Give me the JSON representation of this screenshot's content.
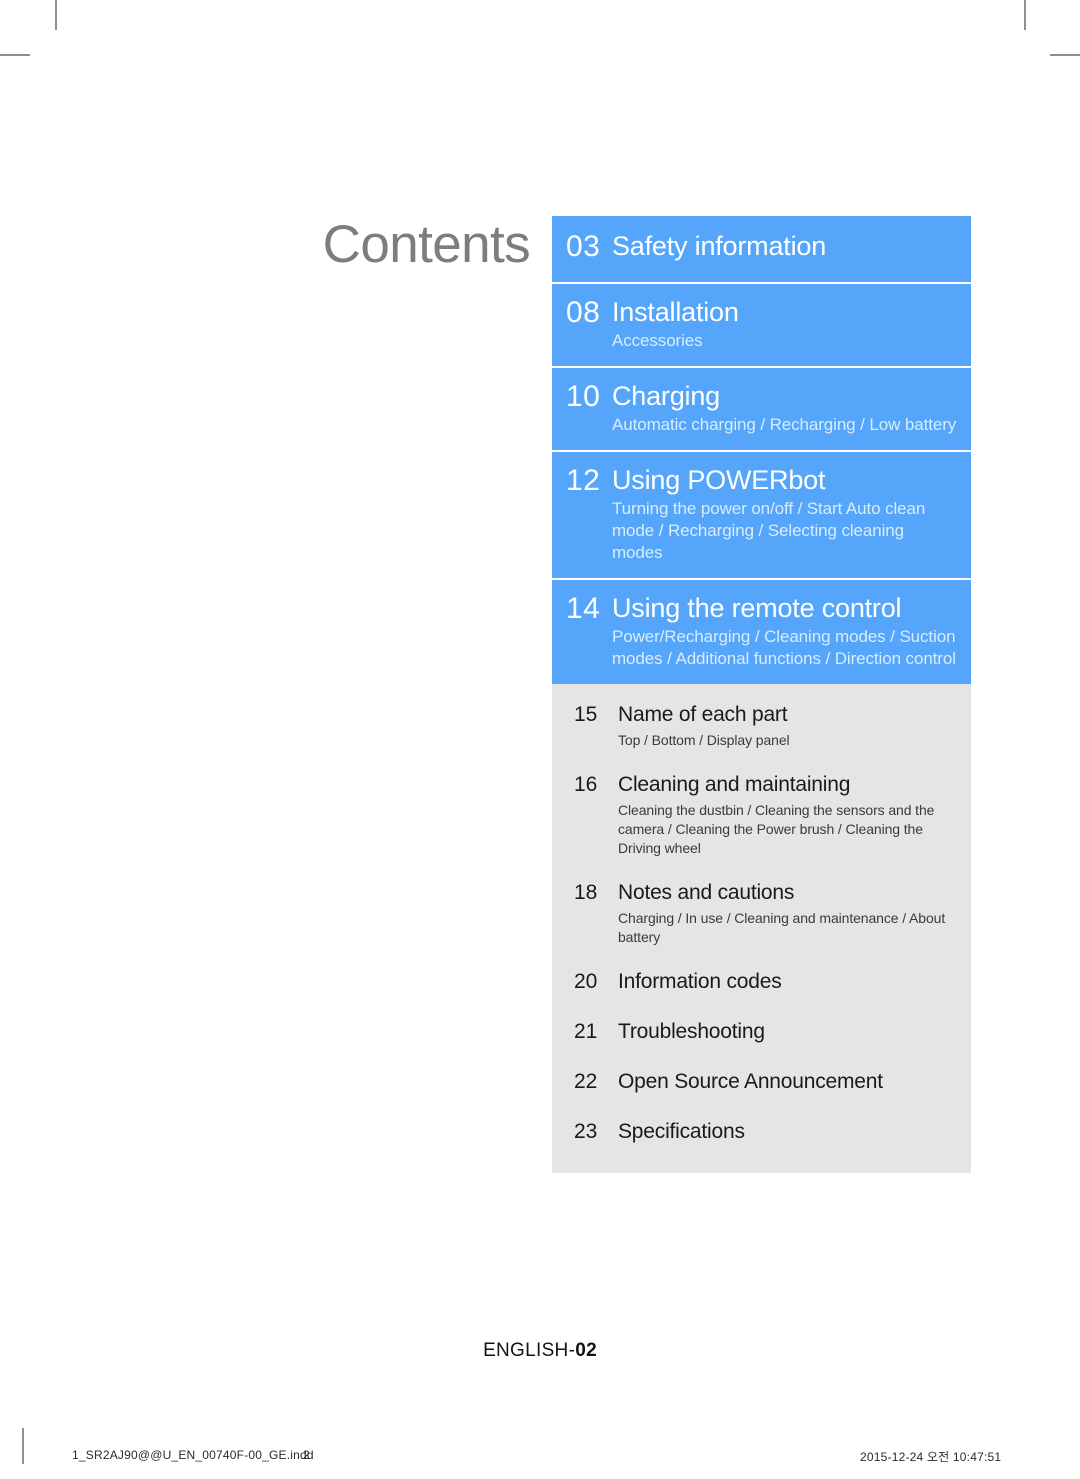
{
  "page": {
    "title": "Contents",
    "english_footer_label": "ENGLISH-",
    "english_footer_page": "02"
  },
  "toc": {
    "blue_entries": [
      {
        "page": "03",
        "title": "Safety information",
        "subtitle": ""
      },
      {
        "page": "08",
        "title": "Installation",
        "subtitle": "Accessories"
      },
      {
        "page": "10",
        "title": "Charging",
        "subtitle": "Automatic charging / Recharging / Low battery"
      },
      {
        "page": "12",
        "title": "Using POWERbot",
        "subtitle": "Turning the power on/off / Start Auto clean mode /  Recharging / Selecting cleaning modes"
      },
      {
        "page": "14",
        "title": "Using the remote control",
        "subtitle": "Power/Recharging / Cleaning modes / Suction modes / Additional functions / Direction control"
      }
    ],
    "gray_entries": [
      {
        "page": "15",
        "title": "Name of each part",
        "subtitle": "Top / Bottom / Display panel"
      },
      {
        "page": "16",
        "title": "Cleaning and maintaining",
        "subtitle": "Cleaning the dustbin / Cleaning the sensors and the camera / Cleaning the Power brush / Cleaning the Driving wheel"
      },
      {
        "page": "18",
        "title": "Notes and cautions",
        "subtitle": "Charging / In use / Cleaning and maintenance / About battery"
      },
      {
        "page": "20",
        "title": "Information codes",
        "subtitle": ""
      },
      {
        "page": "21",
        "title": "Troubleshooting",
        "subtitle": ""
      },
      {
        "page": "22",
        "title": "Open Source Announcement",
        "subtitle": ""
      },
      {
        "page": "23",
        "title": "Specifications",
        "subtitle": ""
      }
    ]
  },
  "print_footer": {
    "filename": "1_SR2AJ90@@U_EN_00740F-00_GE.indd",
    "page_number": "2",
    "timestamp": "2015-12-24   오전 10:47:51"
  },
  "colors": {
    "accent_blue": "#55a5fa",
    "panel_gray": "#e5e5e5",
    "title_gray": "#7d7d7d",
    "blue_subtitle": "#d9ecfe"
  }
}
